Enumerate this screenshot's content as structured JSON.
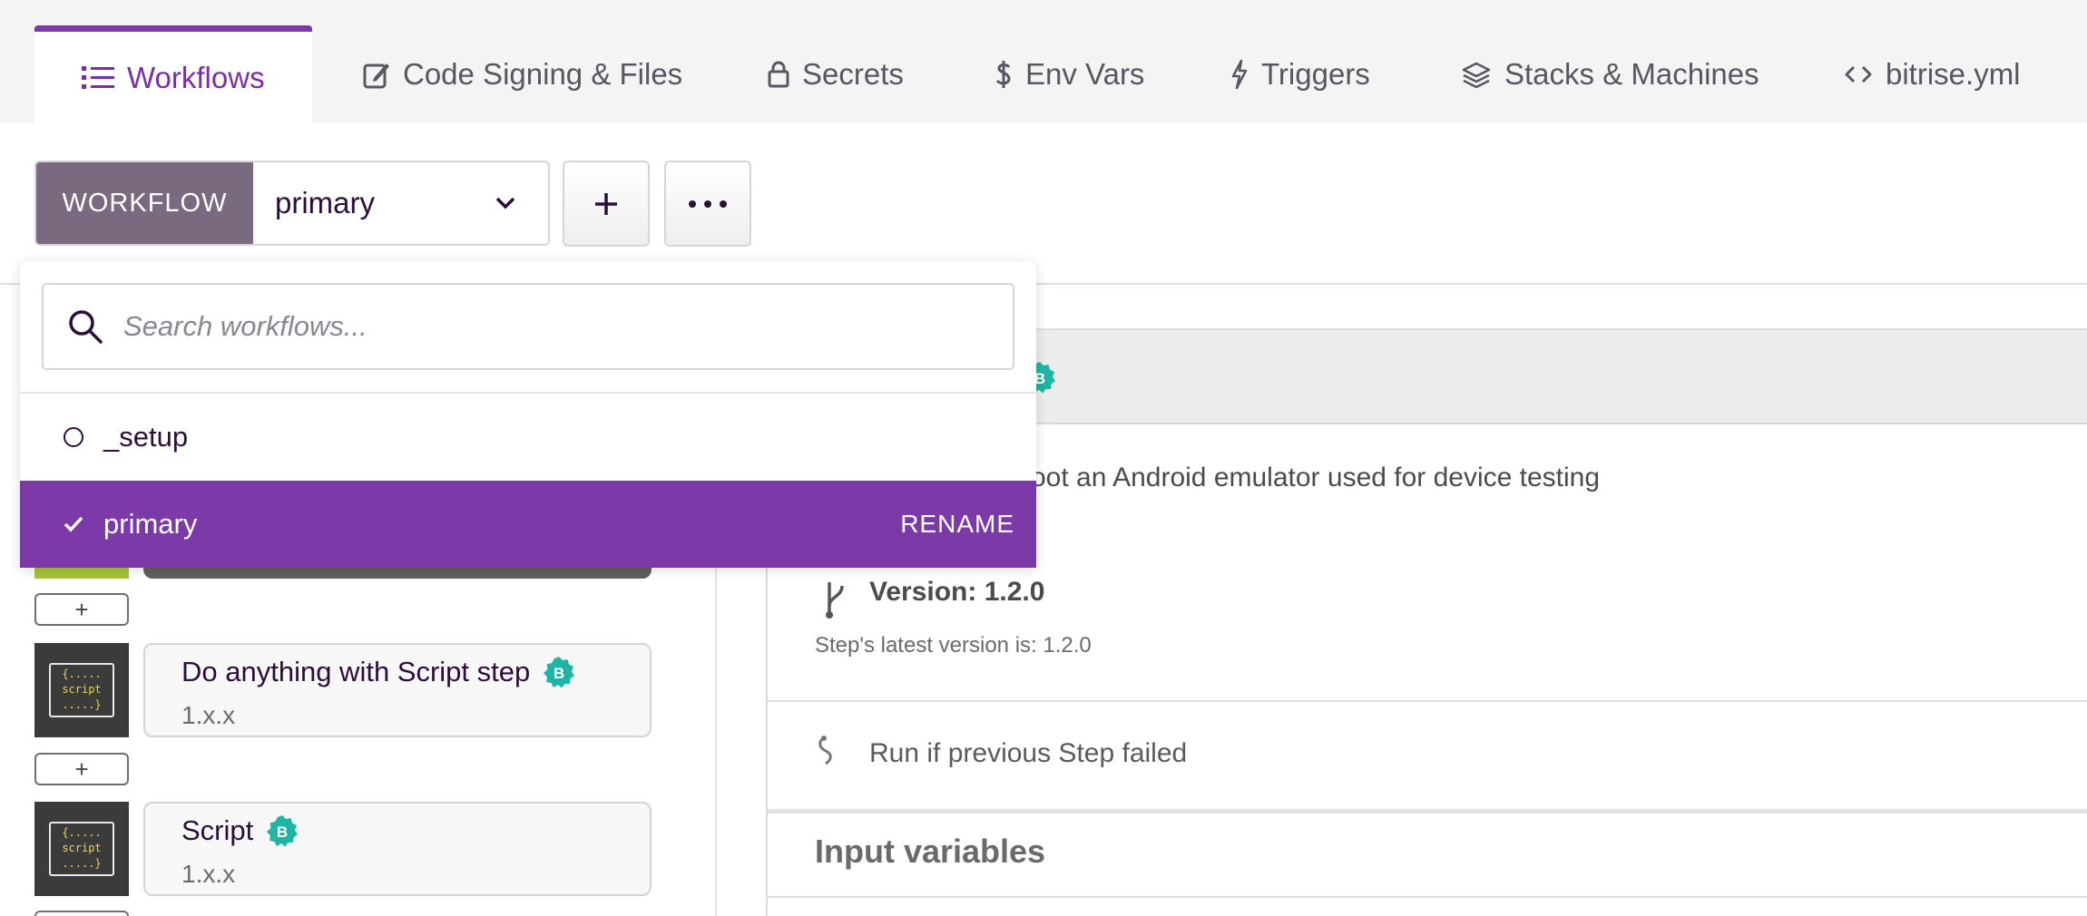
{
  "tabs": [
    {
      "label": "Workflows",
      "icon": "list-icon",
      "active": true
    },
    {
      "label": "Code Signing & Files",
      "icon": "edit-document-icon"
    },
    {
      "label": "Secrets",
      "icon": "lock-icon"
    },
    {
      "label": "Env Vars",
      "icon": "dollar-icon"
    },
    {
      "label": "Triggers",
      "icon": "lightning-icon"
    },
    {
      "label": "Stacks & Machines",
      "icon": "layers-icon"
    },
    {
      "label": "bitrise.yml",
      "icon": "code-icon"
    }
  ],
  "toolbar": {
    "workflow_label": "WORKFLOW",
    "selected_workflow": "primary",
    "add_icon": "plus-icon",
    "more_icon": "ellipsis-icon"
  },
  "dropdown": {
    "search_placeholder": "Search workflows...",
    "items": [
      {
        "label": "_setup",
        "selected": false
      },
      {
        "label": "primary",
        "selected": true,
        "action": "RENAME"
      }
    ]
  },
  "steps": [
    {
      "title": "Do anything with Script step",
      "version": "1.x.x",
      "badge": "B",
      "thumb": "{.....\nscript\n.....}"
    },
    {
      "title": "Script",
      "version": "1.x.x",
      "badge": "B",
      "thumb": "{.....\nscript\n.....}"
    }
  ],
  "add_step_label": "+",
  "details": {
    "badge": "B",
    "description": "oot an Android emulator used for device testing",
    "version": "Version: 1.2.0",
    "latest_version": "Step's latest version is: 1.2.0",
    "run_if": "Run if previous Step failed",
    "inputs_heading": "Input variables"
  },
  "colors": {
    "accent": "#7b3aa8",
    "badge": "#1fb5a4",
    "workflow_label_bg": "#7a6a80"
  }
}
